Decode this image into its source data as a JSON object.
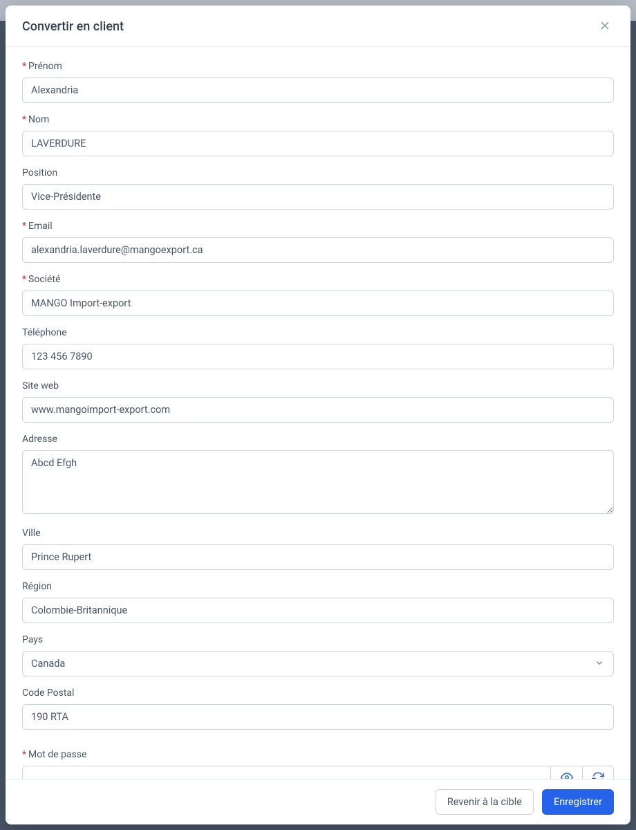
{
  "modal": {
    "title": "Convertir en client",
    "fields": {
      "firstname": {
        "label": "Prénom",
        "value": "Alexandria",
        "required": true
      },
      "lastname": {
        "label": "Nom",
        "value": "LAVERDURE",
        "required": true
      },
      "position": {
        "label": "Position",
        "value": "Vice-Présidente",
        "required": false
      },
      "email": {
        "label": "Email",
        "value": "alexandria.laverdure@mangoexport.ca",
        "required": true
      },
      "company": {
        "label": "Société",
        "value": "MANGO Import-export",
        "required": true
      },
      "phone": {
        "label": "Téléphone",
        "value": "123 456 7890",
        "required": false
      },
      "website": {
        "label": "Site web",
        "value": "www.mangoimport-export.com",
        "required": false
      },
      "address": {
        "label": "Adresse",
        "value": "Abcd Efgh",
        "required": false
      },
      "city": {
        "label": "Ville",
        "value": "Prince Rupert",
        "required": false
      },
      "region": {
        "label": "Région",
        "value": "Colombie-Britannique",
        "required": false
      },
      "country": {
        "label": "Pays",
        "value": "Canada",
        "required": false
      },
      "postal": {
        "label": "Code Postal",
        "value": "190 RTA",
        "required": false
      },
      "password": {
        "label": "Mot de passe",
        "value": "",
        "required": true
      }
    },
    "footer": {
      "back": "Revenir à la cible",
      "save": "Enregistrer"
    }
  }
}
